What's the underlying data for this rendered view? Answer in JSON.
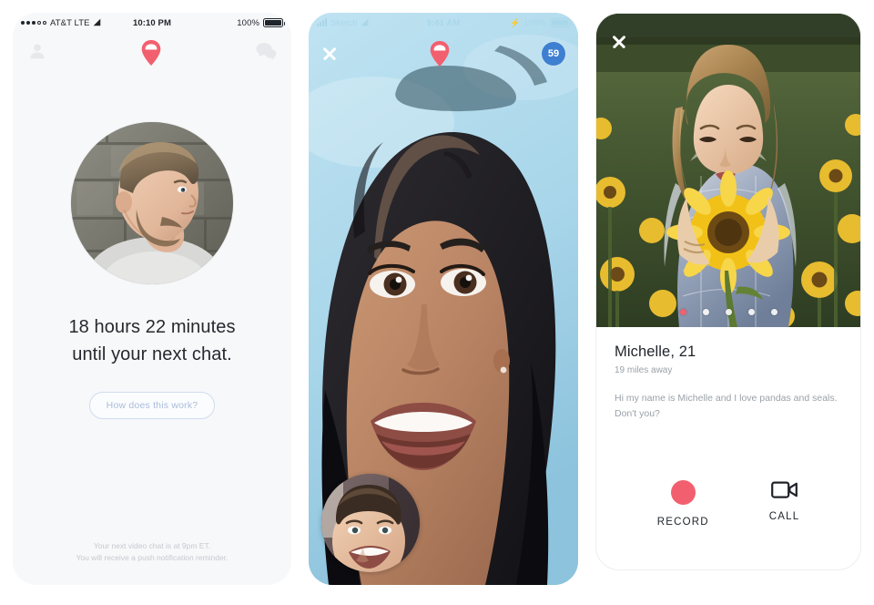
{
  "app": {
    "name": "Video Dating App",
    "accent": "#f2606f",
    "badge_blue": "#3e7fd1",
    "muted_text": "#9aa1a8"
  },
  "panel1": {
    "name": "waiting-screen",
    "statusbar": {
      "carrier": "AT&T LTE",
      "time": "10:10 PM",
      "battery_percent": "100%",
      "wifi_icon": "wifi-icon",
      "signal_icon": "signal-dots-icon",
      "battery_icon": "battery-full-icon"
    },
    "nav": {
      "profile_icon": "person-icon",
      "logo_icon": "pin-logo-icon",
      "chat_icon": "chat-bubbles-icon"
    },
    "avatar": {
      "name": "user-avatar",
      "alt": "Bearded man in profile against stone wall"
    },
    "headline_line1": "18 hours 22 minutes",
    "headline_line2": "until your next chat.",
    "cta_label": "How does this work?",
    "footer_line1": "Your next video chat is at 9pm ET.",
    "footer_line2": "You will receive a push notification reminder."
  },
  "panel2": {
    "name": "live-video-call",
    "statusbar": {
      "carrier": "Sketch",
      "time": "9:41 AM",
      "battery_percent": "100%",
      "wifi_icon": "wifi-icon",
      "signal_icon": "signal-bars-icon",
      "charging_icon": "bolt-icon",
      "battery_icon": "battery-full-icon"
    },
    "nav": {
      "close_icon": "close-x-icon",
      "logo_icon": "pin-logo-icon",
      "timer_label": "59"
    },
    "video": {
      "name": "remote-video-feed",
      "alt": "Smiling woman with dark hair against blue sky"
    },
    "pip": {
      "name": "self-view-thumbnail",
      "alt": "Smiling man self view"
    }
  },
  "panel3": {
    "name": "profile-card",
    "close_icon": "close-x-icon",
    "photo": {
      "name": "profile-photo",
      "alt": "Woman holding a sunflower in a sunflower field"
    },
    "photo_dots": {
      "count": 5,
      "active_index": 0
    },
    "name_age": "Michelle, 21",
    "distance": "19 miles away",
    "bio_line1": "Hi my name is Michelle and I love pandas and seals.",
    "bio_line2": "Don't you?",
    "actions": [
      {
        "label": "RECORD",
        "icon": "record-dot-icon"
      },
      {
        "label": "CALL",
        "icon": "video-camera-icon"
      }
    ]
  }
}
